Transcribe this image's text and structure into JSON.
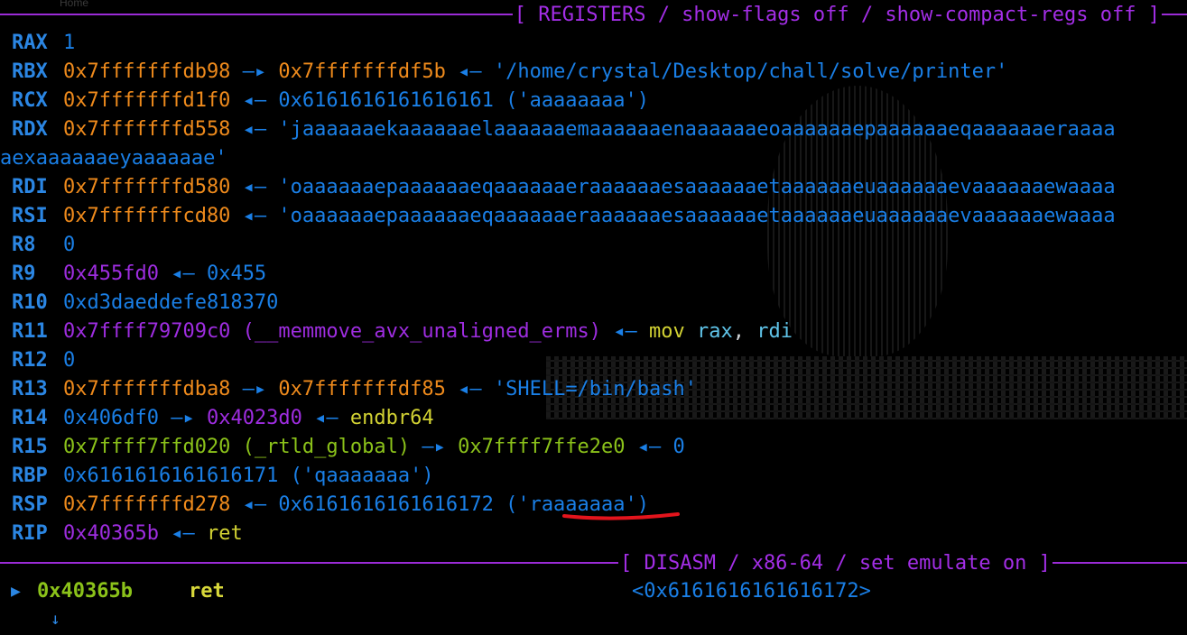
{
  "background_ghost": "Home",
  "registers_header": {
    "title": "[ REGISTERS / show-flags off / show-compact-regs off ]",
    "color": "#9b2bd6"
  },
  "registers": [
    {
      "name": "RAX",
      "parts": [
        {
          "text": "1",
          "color": "c-blue"
        }
      ]
    },
    {
      "name": "RBX",
      "parts": [
        {
          "text": "0x7fffffffdb98",
          "color": "c-orange"
        },
        {
          "text": " —▸ ",
          "color": "arrow"
        },
        {
          "text": "0x7fffffffdf5b",
          "color": "c-orange"
        },
        {
          "text": " ◂— ",
          "color": "arrow"
        },
        {
          "text": "'/home/crystal/Desktop/chall/solve/printer'",
          "color": "c-blue"
        }
      ]
    },
    {
      "name": "RCX",
      "parts": [
        {
          "text": "0x7fffffffd1f0",
          "color": "c-orange"
        },
        {
          "text": " ◂— ",
          "color": "arrow"
        },
        {
          "text": "0x6161616161616161 ('aaaaaaaa')",
          "color": "c-blue"
        }
      ]
    },
    {
      "name": "RDX",
      "parts": [
        {
          "text": "0x7fffffffd558",
          "color": "c-orange"
        },
        {
          "text": " ◂— ",
          "color": "arrow"
        },
        {
          "text": "'jaaaaaaekaaaaaaelaaaaaaemaaaaaaenaaaaaaeoaaaaaaepaaaaaaeqaaaaaaeraaaa",
          "color": "c-blue"
        }
      ]
    },
    {
      "name": "",
      "wrap": true,
      "parts": [
        {
          "text": "aexaaaaaaeyaaaaaae'",
          "color": "c-blue"
        }
      ]
    },
    {
      "name": "RDI",
      "parts": [
        {
          "text": "0x7fffffffd580",
          "color": "c-orange"
        },
        {
          "text": " ◂— ",
          "color": "arrow"
        },
        {
          "text": "'oaaaaaaepaaaaaaeqaaaaaaeraaaaaaesaaaaaaetaaaaaaeuaaaaaaevaaaaaaewaaaa",
          "color": "c-blue"
        }
      ]
    },
    {
      "name": "RSI",
      "parts": [
        {
          "text": "0x7fffffffcd80",
          "color": "c-orange"
        },
        {
          "text": " ◂— ",
          "color": "arrow"
        },
        {
          "text": "'oaaaaaaepaaaaaaeqaaaaaaeraaaaaaesaaaaaaetaaaaaaeuaaaaaaevaaaaaaewaaaa",
          "color": "c-blue"
        }
      ]
    },
    {
      "name": "R8",
      "parts": [
        {
          "text": "0",
          "color": "c-blue"
        }
      ]
    },
    {
      "name": "R9",
      "parts": [
        {
          "text": "0x455fd0",
          "color": "c-purple"
        },
        {
          "text": " ◂— ",
          "color": "arrow"
        },
        {
          "text": "0x455",
          "color": "c-blue"
        }
      ]
    },
    {
      "name": "R10",
      "parts": [
        {
          "text": "0xd3daeddefe818370",
          "color": "c-blue"
        }
      ]
    },
    {
      "name": "R11",
      "parts": [
        {
          "text": "0x7ffff79709c0 (__memmove_avx_unaligned_erms)",
          "color": "c-purple"
        },
        {
          "text": " ◂— ",
          "color": "arrow"
        },
        {
          "text": "mov ",
          "color": "c-yellow"
        },
        {
          "text": "rax",
          "color": "c-cyan"
        },
        {
          "text": ", ",
          "color": "c-white"
        },
        {
          "text": "rdi",
          "color": "c-cyan"
        }
      ]
    },
    {
      "name": "R12",
      "parts": [
        {
          "text": "0",
          "color": "c-blue"
        }
      ]
    },
    {
      "name": "R13",
      "parts": [
        {
          "text": "0x7fffffffdba8",
          "color": "c-orange"
        },
        {
          "text": " —▸ ",
          "color": "arrow"
        },
        {
          "text": "0x7fffffffdf85",
          "color": "c-orange"
        },
        {
          "text": " ◂— ",
          "color": "arrow"
        },
        {
          "text": "'SHELL=/bin/bash'",
          "color": "c-blue"
        }
      ]
    },
    {
      "name": "R14",
      "parts": [
        {
          "text": "0x406df0",
          "color": "c-blue"
        },
        {
          "text": " —▸ ",
          "color": "arrow"
        },
        {
          "text": "0x4023d0",
          "color": "c-purple"
        },
        {
          "text": " ◂— ",
          "color": "arrow"
        },
        {
          "text": "endbr64",
          "color": "c-yellow"
        }
      ]
    },
    {
      "name": "R15",
      "parts": [
        {
          "text": "0x7ffff7ffd020 (_rtld_global)",
          "color": "c-green"
        },
        {
          "text": " —▸ ",
          "color": "arrow"
        },
        {
          "text": "0x7ffff7ffe2e0",
          "color": "c-green"
        },
        {
          "text": " ◂— ",
          "color": "arrow"
        },
        {
          "text": "0",
          "color": "c-blue"
        }
      ]
    },
    {
      "name": "RBP",
      "parts": [
        {
          "text": "0x6161616161616171 ('qaaaaaaa')",
          "color": "c-blue"
        }
      ]
    },
    {
      "name": "RSP",
      "parts": [
        {
          "text": "0x7fffffffd278",
          "color": "c-orange"
        },
        {
          "text": " ◂— ",
          "color": "arrow"
        },
        {
          "text": "0x6161616161616172 ('raaaaaaa')",
          "color": "c-blue"
        }
      ]
    },
    {
      "name": "RIP",
      "parts": [
        {
          "text": "0x40365b",
          "color": "c-purple"
        },
        {
          "text": " ◂— ",
          "color": "arrow"
        },
        {
          "text": "ret",
          "color": "c-yellow"
        }
      ]
    }
  ],
  "disasm_header": {
    "title": "[ DISASM / x86-64 / set emulate on ]"
  },
  "disasm": {
    "marker": "▶",
    "address": "0x40365b",
    "instruction": "ret",
    "target": "<0x6161616161616172>",
    "next_marker": "↓"
  },
  "annotation": {
    "underline_color": "#e3141c"
  }
}
